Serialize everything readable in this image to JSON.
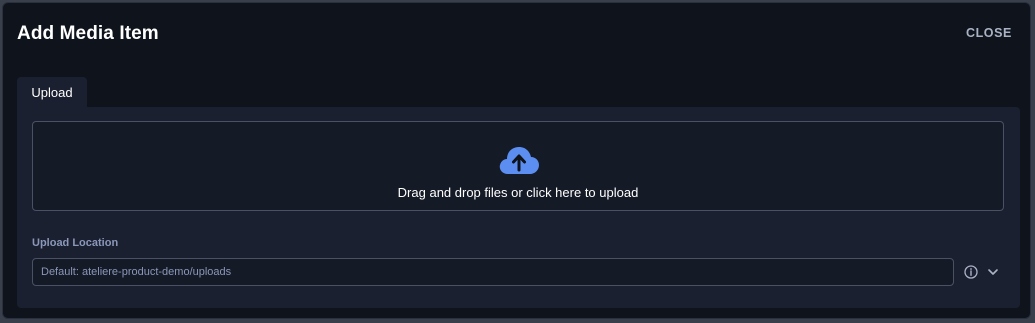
{
  "dialog": {
    "title": "Add Media Item",
    "close_label": "CLOSE"
  },
  "tabs": [
    {
      "label": "Upload",
      "active": true
    }
  ],
  "dropzone": {
    "icon": "cloud-upload-icon",
    "text": "Drag and drop files or click here to upload"
  },
  "upload_location": {
    "label": "Upload Location",
    "placeholder": "Default: ateliere-product-demo/uploads",
    "value": "",
    "info_icon": "info-icon",
    "dropdown_icon": "chevron-down-icon"
  },
  "colors": {
    "background": "#0f131c",
    "panel": "#1b2030",
    "accent": "#5b8ef0",
    "muted_text": "#8a97b8"
  }
}
